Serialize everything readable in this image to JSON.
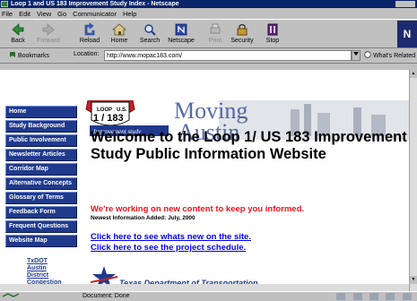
{
  "window": {
    "title": "Loop 1 and US 183 Improvement Study Index - Netscape"
  },
  "menu": [
    "File",
    "Edit",
    "View",
    "Go",
    "Communicator",
    "Help"
  ],
  "toolbar": {
    "buttons": [
      {
        "label": "Back",
        "icon": "back-arrow-icon",
        "enabled": true
      },
      {
        "label": "Forward",
        "icon": "forward-arrow-icon",
        "enabled": false
      },
      {
        "label": "Reload",
        "icon": "reload-icon",
        "enabled": true
      },
      {
        "label": "Home",
        "icon": "home-icon",
        "enabled": true
      },
      {
        "label": "Search",
        "icon": "search-icon",
        "enabled": true
      },
      {
        "label": "Netscape",
        "icon": "netscape-icon",
        "enabled": true
      },
      {
        "label": "Print",
        "icon": "print-icon",
        "enabled": false
      },
      {
        "label": "Security",
        "icon": "security-lock-icon",
        "enabled": true
      },
      {
        "label": "Stop",
        "icon": "stop-icon",
        "enabled": true
      }
    ],
    "logo_letter": "N"
  },
  "location": {
    "bookmarks_label": "Bookmarks",
    "location_label": "Location:",
    "url": "http://www.mopac183.com/",
    "whats_related": "What's Related"
  },
  "sidebar": {
    "items": [
      "Home",
      "Study Background",
      "Public Involvement",
      "Newsletter Articles",
      "Corridor Map",
      "Alternative Concepts",
      "Glossary of Terms",
      "Feedback Form",
      "Frequent Questions",
      "Website Map"
    ],
    "txdot_link": [
      "TxDOT",
      "Austin",
      "District",
      "Congestion"
    ]
  },
  "banner": {
    "shield_loop": "LOOP",
    "shield_us": "U.S.",
    "shield_numbers": "1 / 183",
    "improvement_study": "Improvement study",
    "word1": "Moving",
    "word2": "Austin"
  },
  "main": {
    "welcome": "Welcome to the Loop 1/ US 183 Improvement Study Public Information Website",
    "notice": "We're working on new content to keep you informed.",
    "newest": "Newest Information Added: July, 2000",
    "link_news": "Click here to see whats new on the site.",
    "link_schedule": "Click here to see the project schedule.",
    "txdot_logo_text": "Texas Department of Transportation"
  },
  "status": {
    "text": "Document: Done"
  },
  "colors": {
    "nav_blue": "#1f3a8c",
    "notice_red": "#e8141b",
    "link_blue": "#0000ee",
    "title_navy": "#0a246a"
  }
}
